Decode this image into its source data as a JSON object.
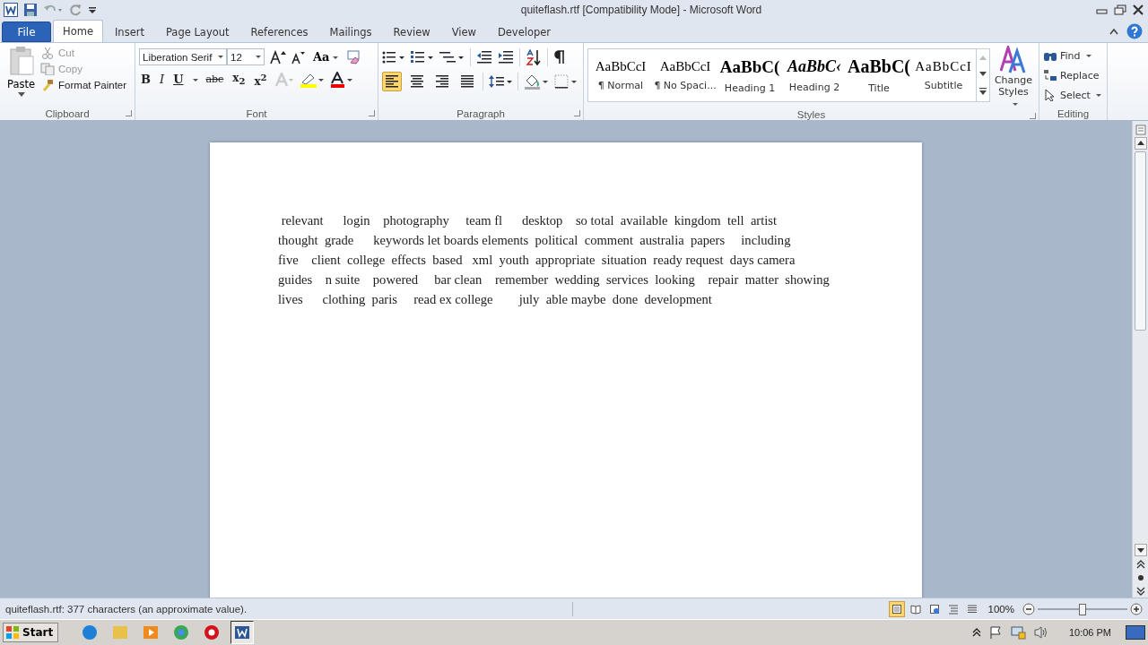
{
  "window": {
    "title": "quiteflash.rtf [Compatibility Mode]  -  Microsoft Word"
  },
  "tabs": [
    {
      "label": "File",
      "kind": "file",
      "selected": false
    },
    {
      "label": "Home",
      "kind": "tab",
      "selected": true
    },
    {
      "label": "Insert",
      "kind": "tab",
      "selected": false
    },
    {
      "label": "Page Layout",
      "kind": "tab",
      "selected": false
    },
    {
      "label": "References",
      "kind": "tab",
      "selected": false
    },
    {
      "label": "Mailings",
      "kind": "tab",
      "selected": false
    },
    {
      "label": "Review",
      "kind": "tab",
      "selected": false
    },
    {
      "label": "View",
      "kind": "tab",
      "selected": false
    },
    {
      "label": "Developer",
      "kind": "tab",
      "selected": false
    }
  ],
  "clipboard": {
    "label": "Clipboard",
    "paste": "Paste",
    "items": [
      {
        "label": "Cut",
        "kind": "cut",
        "disabled": true
      },
      {
        "label": "Copy",
        "kind": "copy",
        "disabled": true
      },
      {
        "label": "Format Painter",
        "kind": "painter",
        "disabled": false
      }
    ]
  },
  "font": {
    "label": "Font",
    "font_name": "Liberation Serif",
    "font_size": "12",
    "aa": "Aa",
    "format_buttons": [
      {
        "label": "B",
        "kind": "bold"
      },
      {
        "label": "I",
        "kind": "italic"
      },
      {
        "label": "U",
        "kind": "underline"
      },
      {
        "label": "abc",
        "kind": "strikethrough"
      },
      {
        "label": "x$_{2}$",
        "kind": "subscript"
      },
      {
        "label": "x$^{2}$",
        "kind": "superscript"
      }
    ]
  },
  "paragraph": {
    "label": "Paragraph",
    "alignments": [
      {
        "kind": "left",
        "selected": true
      },
      {
        "kind": "center",
        "selected": false
      },
      {
        "kind": "right",
        "selected": false
      },
      {
        "kind": "justify",
        "selected": false
      }
    ]
  },
  "styles": {
    "label": "Styles",
    "items": [
      {
        "preview": "AaBbCcI",
        "name": "¶ Normal",
        "kind": "normal"
      },
      {
        "preview": "AaBbCcI",
        "name": "¶ No Spaci...",
        "kind": "nospace"
      },
      {
        "preview": "AaBbC(",
        "name": "Heading 1",
        "kind": "heading1"
      },
      {
        "preview": "AaBbC‹",
        "name": "Heading 2",
        "kind": "heading2"
      },
      {
        "preview": "AaBbC(",
        "name": "Title",
        "kind": "title"
      },
      {
        "preview": "AaBbCcI",
        "name": "Subtitle",
        "kind": "subtitle"
      }
    ],
    "change_styles": [
      "Change",
      "Styles"
    ]
  },
  "editing": {
    "label": "Editing",
    "items": [
      {
        "label": "Find",
        "kind": "find"
      },
      {
        "label": "Replace",
        "kind": "replace"
      },
      {
        "label": "Select",
        "kind": "select"
      }
    ]
  },
  "document": {
    "lines": [
      " relevant      login    photography     team fl      desktop    so total  available  kingdom  tell  artist",
      "thought  grade      keywords let boards elements  political  comment  australia  papers     including",
      "five    client  college  effects  based   xml  youth  appropriate  situation  ready request  days camera",
      "guides    n suite    powered     bar clean    remember  wedding  services  looking    repair  matter  showing",
      "lives      clothing  paris     read ex college        july  able maybe  done  development"
    ]
  },
  "status_bar": {
    "text": "quiteflash.rtf: 377 characters (an approximate value).",
    "views": [
      {
        "kind": "print",
        "selected": true
      },
      {
        "kind": "read",
        "selected": false
      },
      {
        "kind": "web",
        "selected": false
      },
      {
        "kind": "outline",
        "selected": false
      },
      {
        "kind": "draft",
        "selected": false
      }
    ],
    "zoom": "100%",
    "zoom_slider": {
      "level": 0.5
    }
  },
  "taskbar": {
    "start": "Start",
    "apps": [
      {
        "kind": "ie",
        "selected": false
      },
      {
        "kind": "folder",
        "selected": false
      },
      {
        "kind": "media",
        "selected": false
      },
      {
        "kind": "chrome",
        "selected": false
      },
      {
        "kind": "opera",
        "selected": false
      },
      {
        "kind": "word",
        "selected": true
      }
    ],
    "clock": "10:06 PM"
  }
}
